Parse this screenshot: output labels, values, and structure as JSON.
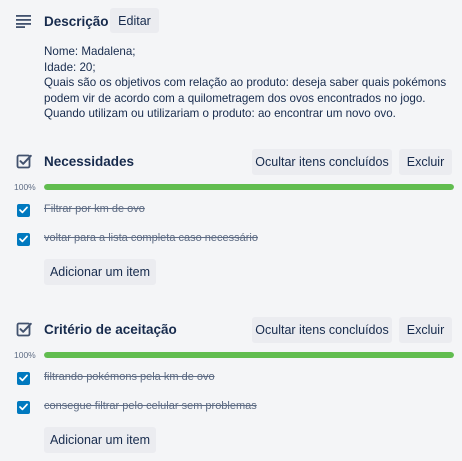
{
  "description": {
    "title": "Descrição",
    "edit_label": "Editar",
    "lines": [
      "Nome: Madalena;",
      "Idade: 20;",
      "Quais são os objetivos com relação ao produto: deseja saber quais pokémons",
      "podem vir de acordo com a quilometragem dos ovos encontrados no jogo.",
      "Quando utilizam ou utilizariam o produto: ao encontrar um novo ovo."
    ]
  },
  "checklists": [
    {
      "title": "Necessidades",
      "hide_label": "Ocultar itens concluídos",
      "delete_label": "Excluir",
      "progress": 100,
      "progress_label": "100%",
      "items": [
        {
          "text": "Filtrar por km de ovo",
          "checked": true
        },
        {
          "text": "voltar para a lista completa caso necessário",
          "checked": true
        }
      ],
      "add_label": "Adicionar um item"
    },
    {
      "title": "Critério de aceitação",
      "hide_label": "Ocultar itens concluídos",
      "delete_label": "Excluir",
      "progress": 100,
      "progress_label": "100%",
      "items": [
        {
          "text": "filtrando pokémons pela km de ovo",
          "checked": true
        },
        {
          "text": "consegue filtrar pelo celular sem problemas",
          "checked": true
        }
      ],
      "add_label": "Adicionar um item"
    }
  ],
  "colors": {
    "progress_fill": "#61bd4f",
    "checkbox": "#0079bf",
    "button_bg": "#ebecf0"
  },
  "icons": {
    "description": "description-lines-icon",
    "checklist": "checklist-icon",
    "checkbox": "checkmark-icon"
  }
}
